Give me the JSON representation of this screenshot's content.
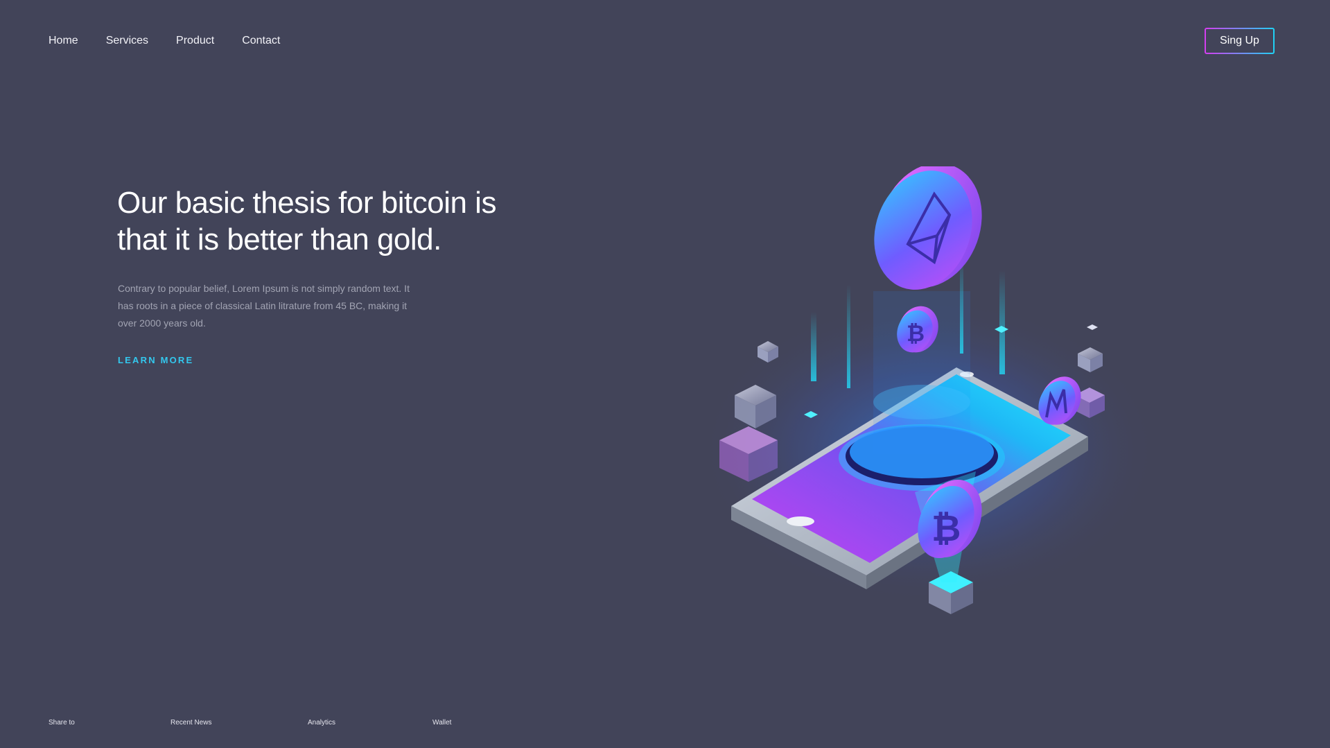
{
  "nav": {
    "items": [
      {
        "label": "Home"
      },
      {
        "label": "Services"
      },
      {
        "label": "Product"
      },
      {
        "label": "Contact"
      }
    ],
    "signup_label": "Sing Up"
  },
  "hero": {
    "title": "Our basic thesis for bitcoin is that it is better than gold.",
    "description": "Contrary to popular belief, Lorem Ipsum is not simply random text. It has roots in a piece of classical Latin litrature from 45 BC, making it over 2000 years old.",
    "cta_label": "LEARN MORE"
  },
  "illustration": {
    "subject": "isometric-crypto-smartphone",
    "coins": [
      "ethereum-icon",
      "bitcoin-icon",
      "monero-icon",
      "bitcoin-icon"
    ]
  },
  "footer": {
    "links": [
      {
        "label": "Share to"
      },
      {
        "label": "Recent News"
      },
      {
        "label": "Analytics"
      },
      {
        "label": "Wallet"
      }
    ]
  },
  "colors": {
    "background": "#424459",
    "accent_cyan": "#33c8ee",
    "accent_magenta": "#d63df0",
    "text_muted": "#a2a4b3"
  }
}
